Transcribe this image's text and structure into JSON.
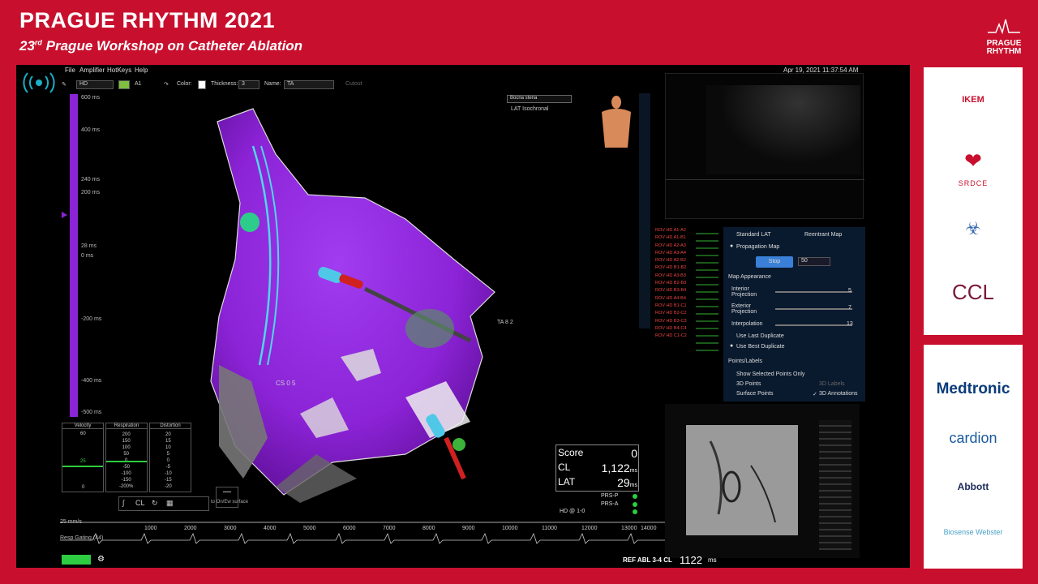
{
  "banner": {
    "title": "PRAGUE RHYTHM 2021",
    "subtitle_prefix": "23",
    "subtitle_sup": "rd",
    "subtitle_rest": " Prague Workshop on Catheter Ablation",
    "logo_line1": "PRAGUE",
    "logo_line2": "RHYTHM"
  },
  "menu": {
    "file": "File",
    "amplifier": "Amplifier",
    "hotkeys": "HotKeys",
    "help": "Help",
    "datetime": "Apr 19, 2021 11:37:54 AM"
  },
  "toolbar": {
    "mode": "HD",
    "channel": "A1",
    "color_label": "Color:",
    "thickness_label": "Thickness:",
    "thickness_value": "3",
    "name_label": "Name:",
    "name_value": "TA",
    "cutout": "Cutout"
  },
  "scale": {
    "labels": [
      "600 ms",
      "400 ms",
      "240 ms",
      "200 ms",
      "28 ms",
      "0 ms",
      "-200 ms",
      "-400 ms",
      "-500 ms"
    ]
  },
  "map": {
    "select_value": "Bocna stena",
    "isochronal": "LAT Isochronal",
    "label_cs": "CS 0 5",
    "label_ta": "TA 8 2"
  },
  "score": {
    "score_label": "Score",
    "score_value": "0",
    "cl_label": "CL",
    "cl_value": "1,122",
    "cl_unit": "ms",
    "lat_label": "LAT",
    "lat_value": "29",
    "lat_unit": "ms",
    "prs_p": "PRS-P",
    "prs_a": "PRS-A",
    "hd_label": "HD @ 1-0"
  },
  "minipanels": {
    "velocity": {
      "title": "Velocity",
      "values": [
        "60",
        "25",
        "0"
      ]
    },
    "respiration": {
      "title": "Respiration",
      "values": [
        "200",
        "150",
        "100",
        "50",
        "0",
        "-50",
        "-100",
        "-150",
        "-200%"
      ]
    },
    "distortion": {
      "title": "Distortion",
      "values": [
        "20",
        "15",
        "10",
        "5",
        "0",
        "-5",
        "-10",
        "-15",
        "-20"
      ]
    }
  },
  "settings": {
    "standard_lat": "Standard LAT",
    "reentrant_map": "Reentrant Map",
    "propagation_map": "Propagation Map",
    "stop_button": "Stop",
    "speed_value": "50",
    "map_appearance": "Map Appearance",
    "interior_projection": "Interior Projection",
    "interior_value": "5",
    "exterior_projection": "Exterior Projection",
    "exterior_value": "7",
    "interpolation": "Interpolation",
    "interpolation_value": "13",
    "use_last_duplicate": "Use Last Duplicate",
    "use_best_duplicate": "Use Best Duplicate",
    "points_labels": "Points/Labels",
    "show_selected_points": "Show Selected Points Only",
    "points_3d": "3D Points",
    "labels_3d": "3D Labels",
    "surface_points": "Surface Points",
    "annotations_3d": "3D Annotations"
  },
  "signals": {
    "labels": [
      "ROV HD A1-A2",
      "ROV HD A1-B1",
      "ROV HD A2-A3",
      "ROV HD A3-A4",
      "ROV HD A2-B2",
      "ROV HD B1-B2",
      "ROV HD A3-B3",
      "ROV HD B2-B3",
      "ROV HD B3-B4",
      "ROV HD A4-B4",
      "ROV HD B1-C1",
      "ROV HD B2-C2",
      "ROV HD B3-C3",
      "ROV HD B4-C4",
      "ROV HD C1-C2"
    ]
  },
  "ecg": {
    "speed": "25 mm/s",
    "resp_gating": "Resp Gating (44)",
    "ticks": [
      "1000",
      "2000",
      "3000",
      "4000",
      "5000",
      "6000",
      "7000",
      "8000",
      "9000",
      "10000",
      "11000",
      "12000",
      "13000",
      "14000"
    ],
    "surface_label": "to On/Ew surface"
  },
  "status": {
    "ref": "REF ABL 3-4 CL",
    "cl": "1122",
    "unit": "ms"
  },
  "sponsors": {
    "ikem": "IKEM",
    "srdce": "SRDCE",
    "ccl": "CCL",
    "medtronic": "Medtronic",
    "cardion": "cardion",
    "abbott": "Abbott",
    "biosense": "Biosense Webster"
  },
  "colors": {
    "brand_red": "#c8102e",
    "map_purple": "#8b23d6",
    "scale_purple": "#8b23d6"
  }
}
